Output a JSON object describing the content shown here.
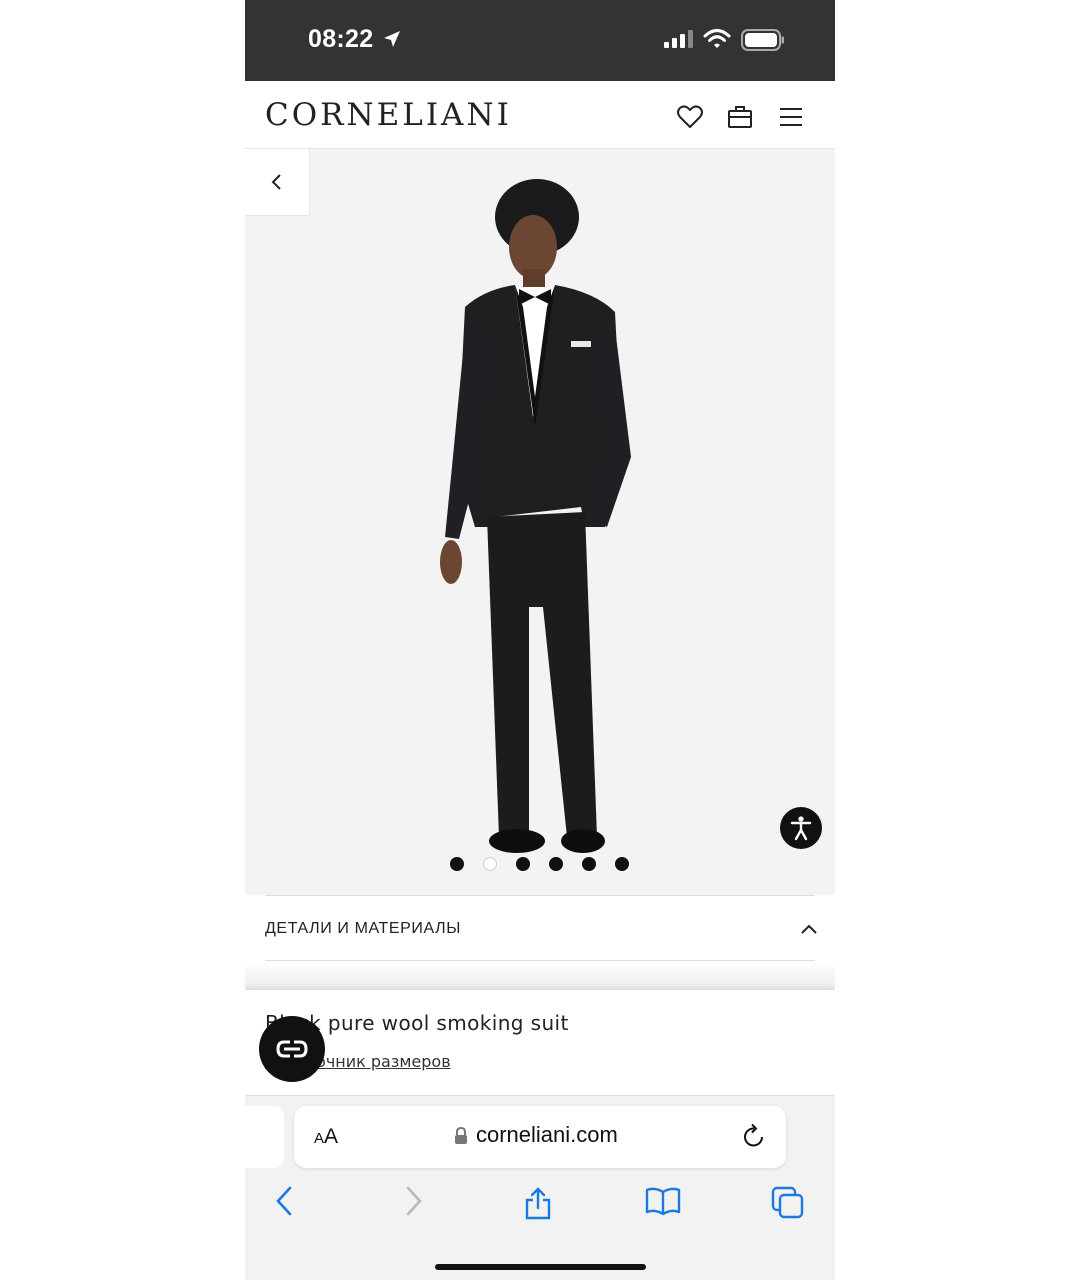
{
  "status_bar": {
    "time": "08:22"
  },
  "header": {
    "brand": "CORNELIANI"
  },
  "gallery": {
    "image_count": 6,
    "active_index": 1
  },
  "details": {
    "title": "ДЕТАЛИ И МАТЕРИАЛЫ"
  },
  "product": {
    "name": "Black pure wool smoking suit",
    "size_guide_label": "Справочник размеров"
  },
  "browser": {
    "text_size_small": "A",
    "text_size_big": "A",
    "url": "corneliani.com"
  },
  "colors": {
    "accent": "#1a7ae0",
    "status_bar_bg": "#333333",
    "button_dark": "#111111"
  }
}
